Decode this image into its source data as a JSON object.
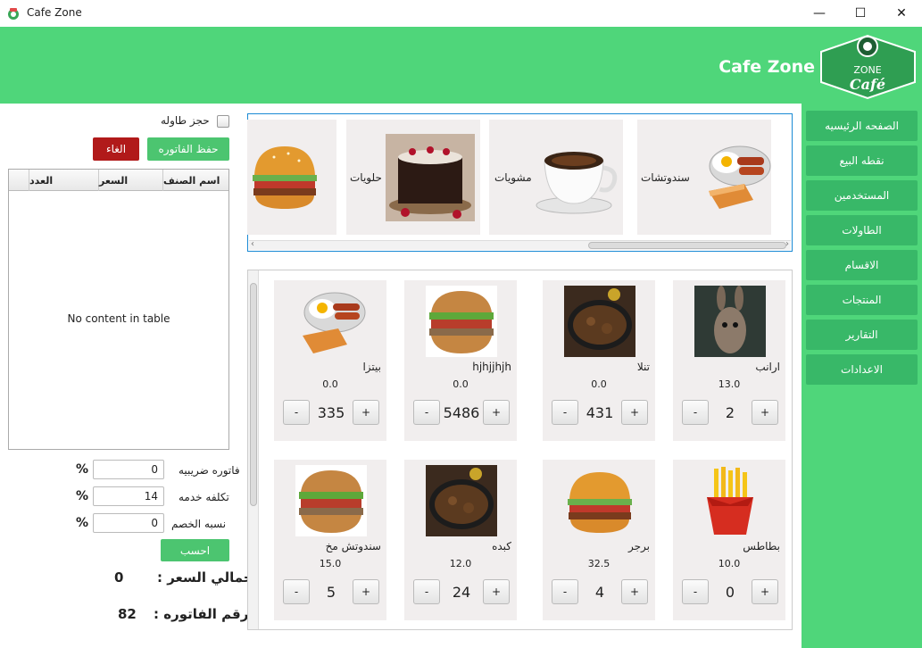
{
  "window": {
    "title": "Cafe Zone",
    "minimize": "—",
    "maximize": "☐",
    "close": "✕"
  },
  "header": {
    "brand": "Cafe Zone",
    "logo_top": "ZONE",
    "logo_bottom": "Café"
  },
  "nav": [
    "الصفحه الرئيسيه",
    "نقطه البيع",
    "المستخدمين",
    "الطاولات",
    "الاقسام",
    "المنتجات",
    "التقارير",
    "الاعدادات"
  ],
  "order": {
    "reserve_label": "حجز طاوله",
    "save_label": "حفظ الفاتوره",
    "cancel_label": "الغاء",
    "columns": [
      "اسم الصنف",
      "السعر",
      "العدد"
    ],
    "empty_text": "No content in table",
    "tax_label": "فاتوره ضريبيه",
    "tax_value": "0",
    "service_label": "تكلفه خدمه",
    "service_value": "14",
    "discount_label": "نسبه الخصم",
    "discount_value": "0",
    "percent": "%",
    "calc_label": "احسب",
    "total_label": "اجمالي السعر :",
    "total_value": "0",
    "invoice_label": "رقم الفاتوره :",
    "invoice_value": "82"
  },
  "categories": [
    {
      "name": "سندوتشات",
      "icon": "breakfast-plate-icon"
    },
    {
      "name": "مشويات",
      "icon": "coffee-cup-icon"
    },
    {
      "name": "حلويات",
      "icon": "cake-icon"
    },
    {
      "name": "",
      "icon": "burger-icon"
    }
  ],
  "products": [
    {
      "name": "ارانب",
      "price": "13.0",
      "qty": "2",
      "icon": "rabbit-photo-icon"
    },
    {
      "name": "تنلا",
      "price": "0.0",
      "qty": "431",
      "icon": "stew-pan-icon"
    },
    {
      "name": "hjhjjhjh",
      "price": "0.0",
      "qty": "5486",
      "icon": "sandwich-icon"
    },
    {
      "name": "بيتزا",
      "price": "0.0",
      "qty": "335",
      "icon": "breakfast-plate-icon"
    },
    {
      "name": "بطاطس",
      "price": "10.0",
      "qty": "0",
      "icon": "fries-icon"
    },
    {
      "name": "برجر",
      "price": "32.5",
      "qty": "4",
      "icon": "burger-icon"
    },
    {
      "name": "كبده",
      "price": "12.0",
      "qty": "24",
      "icon": "stew-pan-icon"
    },
    {
      "name": "سندوتش مخ",
      "price": "15.0",
      "qty": "5",
      "icon": "sandwich-icon"
    }
  ],
  "minus_label": "-",
  "plus_label": "+"
}
